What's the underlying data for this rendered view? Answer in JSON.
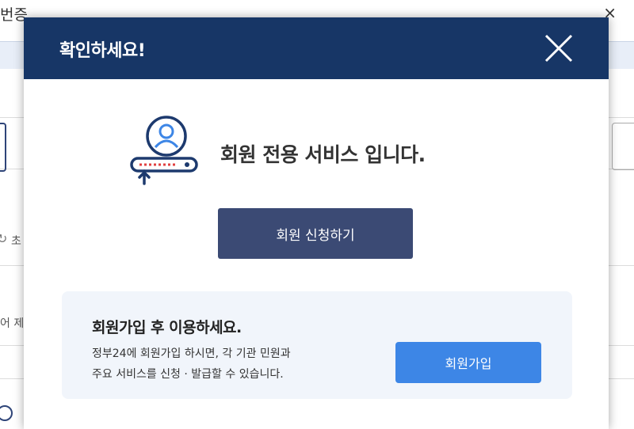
{
  "background": {
    "title_fragment": "번증",
    "close_glyph": "×",
    "text_fragment_1": "초",
    "text_fragment_2": "어 제"
  },
  "modal": {
    "title": "확인하세요!",
    "close_icon": "close-icon",
    "hero_icon": "member-key-icon",
    "hero_text": "회원 전용 서비스 입니다.",
    "apply_button_label": "회원 신청하기",
    "info": {
      "title": "회원가입 후 이용하세요.",
      "description_line1": "정부24에 회원가입 하시면, 각 기관 민원과",
      "description_line2": "주요 서비스를 신청 · 발급할 수 있습니다.",
      "signup_button_label": "회원가입"
    }
  },
  "colors": {
    "header_bg": "#173666",
    "apply_button_bg": "#3b4a74",
    "signup_button_bg": "#3d86e6",
    "info_box_bg": "#f1f5fb"
  }
}
